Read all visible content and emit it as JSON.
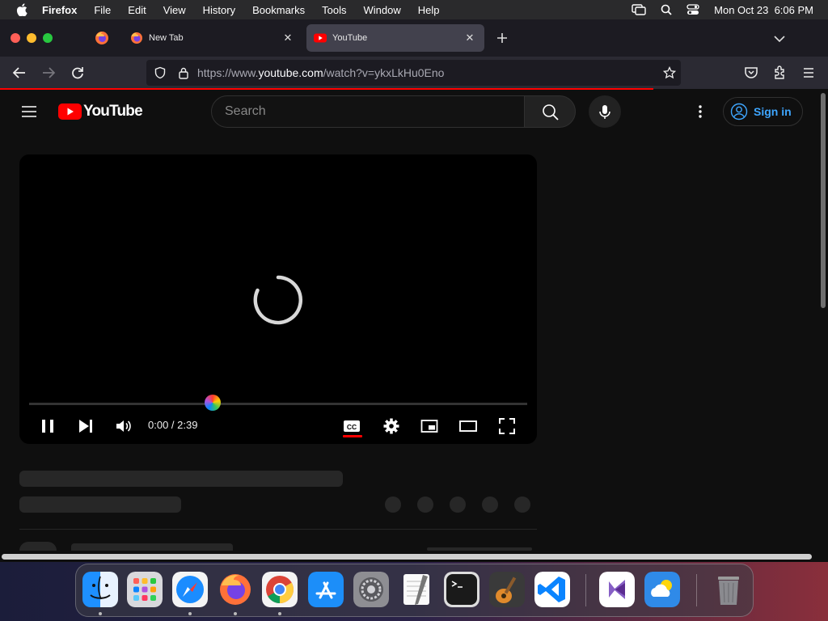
{
  "menubar": {
    "app": "Firefox",
    "items": [
      "File",
      "Edit",
      "View",
      "History",
      "Bookmarks",
      "Tools",
      "Window",
      "Help"
    ],
    "clock": "Mon Oct 23  6:06 PM"
  },
  "tabs": [
    {
      "title": "New Tab",
      "icon": "firefox-icon",
      "active": false
    },
    {
      "title": "YouTube",
      "icon": "youtube-icon",
      "active": true
    }
  ],
  "urlbar": {
    "prefix": "https://www.",
    "domain": "youtube.com",
    "path": "/watch?v=ykxLkHu0Eno"
  },
  "youtube": {
    "logo_text": "YouTube",
    "search_placeholder": "Search",
    "signin_label": "Sign in"
  },
  "player": {
    "time": "0:00 / 2:39",
    "progress_fraction": 0.0,
    "state": "loading"
  },
  "colors": {
    "accent_red": "#ff0000",
    "link_blue": "#3ea6ff",
    "background": "#0f0f0f"
  },
  "dock": {
    "apps": [
      "Finder",
      "Launchpad",
      "Safari",
      "Firefox",
      "Chrome",
      "App Store",
      "System Settings",
      "TextEdit",
      "Terminal",
      "GarageBand",
      "Visual Studio Code",
      "Visual Studio",
      "Weather",
      "Trash"
    ]
  }
}
